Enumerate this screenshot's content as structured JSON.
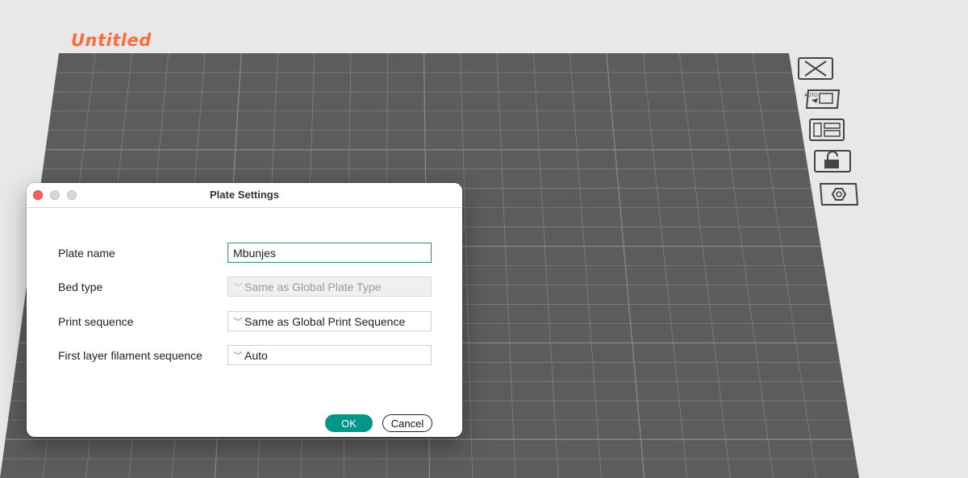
{
  "plate": {
    "title": "Untitled",
    "title_color": "#ff6a3d",
    "bed_color": "#5b5c5b",
    "grid_color": "#8a8b8a",
    "icons": [
      "close-plate-icon",
      "auto-orient-icon",
      "arrange-icon",
      "lock-icon",
      "plate-settings-icon"
    ]
  },
  "dialog": {
    "title": "Plate Settings",
    "fields": {
      "plate_name": {
        "label": "Plate name",
        "value": "Mbunjes"
      },
      "bed_type": {
        "label": "Bed type",
        "value": "Same as Global Plate Type",
        "disabled": true
      },
      "print_sequence": {
        "label": "Print sequence",
        "value": "Same as Global Print Sequence"
      },
      "first_layer": {
        "label": "First layer filament sequence",
        "value": "Auto"
      }
    },
    "ok_label": "OK",
    "cancel_label": "Cancel",
    "accent_color": "#009688"
  }
}
